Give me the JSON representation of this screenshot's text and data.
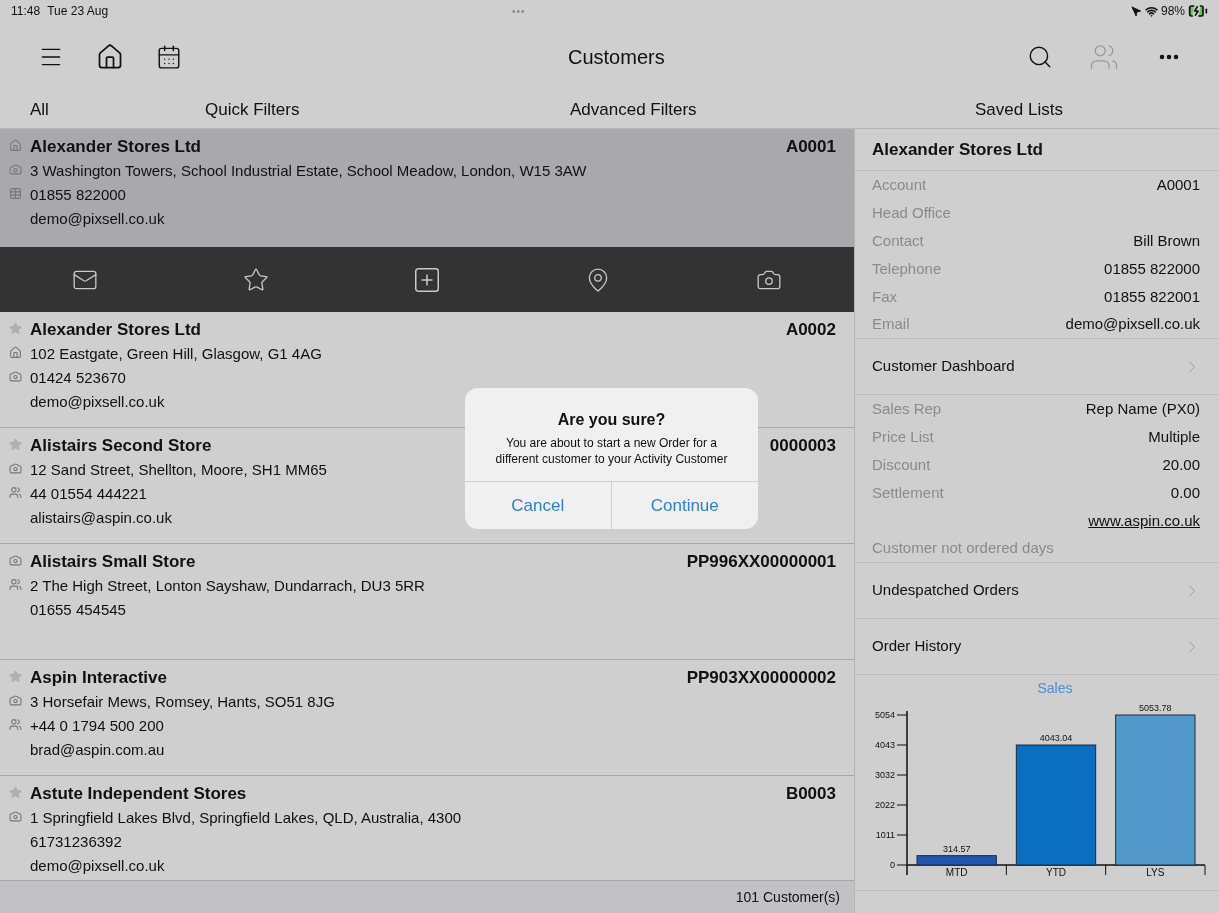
{
  "status_bar": {
    "time": "11:48",
    "date": "Tue 23 Aug",
    "dots": "•••",
    "battery": "98%"
  },
  "nav_bar": {
    "title": "Customers"
  },
  "filter_tabs": [
    {
      "label": "All"
    },
    {
      "label": "Quick Filters"
    },
    {
      "label": "Advanced Filters"
    },
    {
      "label": "Saved Lists"
    }
  ],
  "customers": [
    {
      "name": "Alexander Stores Ltd",
      "code": "A0001",
      "lines": [
        "3 Washington Towers, School Industrial Estate, School Meadow, London, W15 3AW",
        "01855 822000",
        "demo@pixsell.co.uk"
      ],
      "selected": true,
      "star": false,
      "home": true,
      "camera": true,
      "people": false,
      "grid": true
    },
    {
      "name": "Alexander Stores Ltd",
      "code": "A0002",
      "lines": [
        "102 Eastgate, Green Hill, Glasgow, G1 4AG",
        "01424 523670",
        "demo@pixsell.co.uk"
      ],
      "selected": false,
      "star": true,
      "home": true,
      "camera": true,
      "people": false,
      "grid": false
    },
    {
      "name": "Alistairs Second Store",
      "code": "0000003",
      "lines": [
        "12 Sand Street, Shellton, Moore, SH1 MM65",
        "44 01554 444221",
        "alistairs@aspin.co.uk"
      ],
      "selected": false,
      "star": true,
      "home": false,
      "camera": true,
      "people": true,
      "grid": false
    },
    {
      "name": "Alistairs Small Store",
      "code": "PP996XX00000001",
      "lines": [
        "2 The High Street, Lonton Sayshaw, Dundarrach, DU3 5RR",
        "01655 454545"
      ],
      "selected": false,
      "star": false,
      "home": false,
      "camera": true,
      "people": true,
      "grid": false
    },
    {
      "name": "Aspin Interactive",
      "code": "PP903XX00000002",
      "lines": [
        "3 Horsefair Mews, Romsey, Hants, SO51 8JG",
        "+44 0 1794 500 200",
        "brad@aspin.com.au"
      ],
      "selected": false,
      "star": true,
      "home": false,
      "camera": true,
      "people": true,
      "grid": false
    },
    {
      "name": "Astute Independent Stores",
      "code": "B0003",
      "lines": [
        "1 Springfield Lakes Blvd, Springfield Lakes, QLD, Australia, 4300",
        "61731236392",
        "demo@pixsell.co.uk"
      ],
      "selected": false,
      "star": true,
      "home": false,
      "camera": true,
      "people": false,
      "grid": false
    }
  ],
  "footer": {
    "count": "101 Customer(s)"
  },
  "details": {
    "title": "Alexander Stores Ltd",
    "items": [
      {
        "kind": "field",
        "label": "Account",
        "value": "A0001"
      },
      {
        "kind": "field",
        "label": "Head Office"
      },
      {
        "kind": "field",
        "label": "Contact",
        "value": "Bill Brown"
      },
      {
        "kind": "field",
        "label": "Telephone",
        "value": "01855 822000"
      },
      {
        "kind": "field",
        "label": "Fax",
        "value": "01855 822001"
      },
      {
        "kind": "field",
        "label": "Email",
        "value": "demo@pixsell.co.uk"
      },
      {
        "kind": "nav",
        "label": "Customer Dashboard"
      },
      {
        "kind": "field",
        "label": "Sales Rep",
        "value": "Rep Name (PX0)"
      },
      {
        "kind": "field",
        "label": "Price List",
        "value": "Multiple"
      },
      {
        "kind": "field",
        "label": "Discount",
        "value": "20.00"
      },
      {
        "kind": "field",
        "label": "Settlement",
        "value": "0.00"
      },
      {
        "kind": "link",
        "value": "www.aspin.co.uk"
      },
      {
        "kind": "note",
        "label": "Customer not ordered days"
      },
      {
        "kind": "nav",
        "label": "Undespatched Orders"
      },
      {
        "kind": "nav",
        "label": "Order History"
      }
    ],
    "chart_data": {
      "type": "bar",
      "title": "Sales",
      "categories": [
        "MTD",
        "YTD",
        "LYS"
      ],
      "values": [
        314.57,
        4043.04,
        5053.78
      ],
      "colors": [
        "#2356b0",
        "#0a6fc0",
        "#5399cc"
      ],
      "yticks": [
        0,
        1011,
        2022,
        3032,
        4043,
        5054
      ],
      "ylim": [
        0,
        5054
      ],
      "data_labels": true
    }
  },
  "alert": {
    "title": "Are you sure?",
    "message": "You are about to start a new Order for a different customer to your Activity Customer",
    "buttons": [
      "Cancel",
      "Continue"
    ]
  }
}
